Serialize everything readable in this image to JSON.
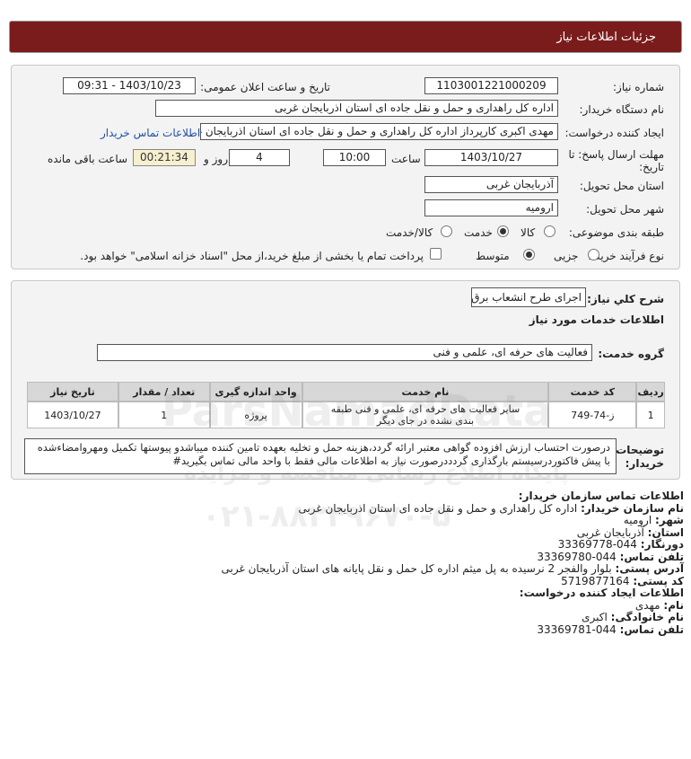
{
  "header": {
    "title": "جزئیات اطلاعات نیاز"
  },
  "form": {
    "need_number_label": "شماره نیاز:",
    "need_number": "1103001221000209",
    "announce_label": "تاریخ و ساعت اعلان عمومی:",
    "announce_value": "1403/10/23 - 09:31",
    "buyer_org_label": "نام دستگاه خریدار:",
    "buyer_org": "اداره کل راهداری و حمل و نقل جاده ای استان اذربایجان غربی",
    "creator_label": "ایجاد کننده درخواست:",
    "creator": "مهدی اکبری کارپرداز اداره کل راهداری و حمل و نقل جاده ای استان اذربایجان غربی",
    "contact_link": "اطلاعات تماس خریدار",
    "deadline_label": "مهلت ارسال پاسخ: تا تاریخ:",
    "deadline_date": "1403/10/27",
    "time_label": "ساعت",
    "deadline_time": "10:00",
    "days_value": "4",
    "days_label": "روز و",
    "remaining_timer": "00:21:34",
    "remaining_label": "ساعت باقی مانده",
    "province_label": "استان محل تحویل:",
    "province": "آذربایجان غربی",
    "city_label": "شهر محل تحویل:",
    "city": "ارومیه",
    "category_label": "طبقه بندی موضوعی:",
    "category_options": [
      "کالا",
      "خدمت",
      "کالا/خدمت"
    ],
    "category_selected": "خدمت",
    "process_label": "نوع فرآیند خرید :",
    "process_options": [
      "جزیی",
      "متوسط"
    ],
    "process_selected": "متوسط",
    "payment_note": "پرداخت تمام یا بخشی از مبلغ خرید،از محل \"اسناد خزانه اسلامی\" خواهد بود."
  },
  "summary": {
    "general_desc_label": "شرح کلي نیاز:",
    "general_desc": "اجرای طرح انشعاب برق",
    "services_info_title": "اطلاعات خدمات مورد نیاز",
    "service_group_label": "گروه خدمت:",
    "service_group": "فعالیت های حرفه ای، علمی و فنی",
    "table": {
      "headers": [
        "ردیف",
        "کد خدمت",
        "نام خدمت",
        "واحد اندازه گیری",
        "تعداد / مقدار",
        "تاریخ نیاز"
      ],
      "rows": [
        [
          "1",
          "ز-74-749",
          "سایر فعالیت های حرفه ای، علمی و فنی طبقه بندی نشده در جای دیگر",
          "پروژه",
          "1",
          "1403/10/27"
        ]
      ]
    },
    "buyer_notes_label": "توضیحات خریدار:",
    "buyer_notes": "درصورت احتساب ارزش افزوده گواهی معتبر ارائه گردد،هزینه حمل و تخلیه بعهده تامین کننده میباشدو پیوستها تکمیل ومهروامضاءشده با پیش فاکتوردرسیستم بارگذاری گردددرصورت نیاز به اطلاعات مالی فقط با واحد مالی تماس بگیرید#"
  },
  "contact": {
    "title": "اطلاعات تماس سازمان خریدار:",
    "org_name_key": "نام سازمان خریدار:",
    "org_name": "اداره کل راهداری و حمل و نقل جاده ای استان اذربایجان غربی",
    "city_key": "شهر:",
    "city": "ارومیه",
    "province_key": "استان:",
    "province": "آذربایجان غربی",
    "fax_key": "دورنگار:",
    "fax": "044-33369778",
    "phone_key": "تلفن تماس:",
    "phone": "044-33369780",
    "address_key": "آدرس پستی:",
    "address": "بلوار والفجر 2 نرسیده به پل میثم اداره کل حمل و نقل پایانه های استان آذربایجان غربی",
    "postal_key": "کد پستی:",
    "postal": "5719877164",
    "creator_title": "اطلاعات ایجاد کننده درخواست:",
    "first_name_key": "نام:",
    "first_name": "مهدی",
    "last_name_key": "نام خانوادگی:",
    "last_name": "اکبری",
    "creator_phone_key": "تلفن تماس:",
    "creator_phone": "044-33369781"
  },
  "watermark": {
    "line1": "ParsNamadData",
    "line2": "پایگاه اطلاع رسانی مناقصه و مزایده",
    "line3": "۰۲۱-۸۸۳۴۹۶۷۰-۵"
  },
  "colors": {
    "header_bg": "#7b1c1c",
    "panel_bg": "#f3f3f3",
    "link": "#1f4fa8",
    "timer_bg": "#f6f0cf"
  }
}
